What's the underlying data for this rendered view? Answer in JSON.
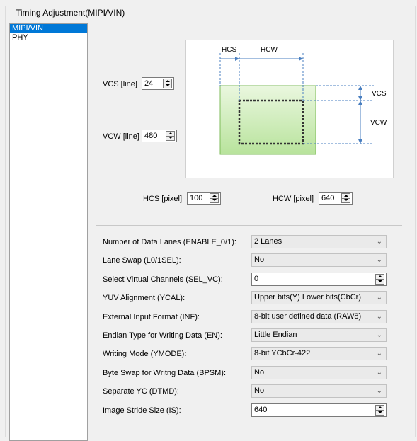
{
  "group": {
    "title": "Timing Adjustment(MIPI/VIN)"
  },
  "nav": {
    "items": [
      "MIPI/VIN",
      "PHY"
    ],
    "selected": "MIPI/VIN"
  },
  "vcs": {
    "label": "VCS [line]",
    "value": "24"
  },
  "vcw": {
    "label": "VCW [line]",
    "value": "480"
  },
  "hcs": {
    "label": "HCS [pixel]",
    "value": "100"
  },
  "hcw": {
    "label": "HCW [pixel]",
    "value": "640"
  },
  "diagram": {
    "hcs_label": "HCS",
    "hcw_label": "HCW",
    "vcs_label": "VCS",
    "vcw_label": "VCW",
    "colors": {
      "fill_top": "#eaf7df",
      "fill_bottom": "#b8e39c",
      "border": "#7dbb58",
      "arrow": "#4a7fc0"
    }
  },
  "settings": [
    {
      "label": "Number of Data Lanes (ENABLE_0/1):",
      "value": "2 Lanes",
      "control": "combo"
    },
    {
      "label": "Lane Swap (L0/1SEL):",
      "value": "No",
      "control": "combo"
    },
    {
      "label": "Select Virtual Channels (SEL_VC):",
      "value": "0",
      "control": "spin"
    },
    {
      "label": "YUV Alignment (YCAL):",
      "value": "Upper bits(Y) Lower bits(CbCr)",
      "control": "combo"
    },
    {
      "label": "External Input Format (INF):",
      "value": "8-bit user defined data (RAW8)",
      "control": "combo"
    },
    {
      "label": "Endian Type for Writing Data (EN):",
      "value": "Little Endian",
      "control": "combo"
    },
    {
      "label": "Writing Mode (YMODE):",
      "value": "8-bit YCbCr-422",
      "control": "combo"
    },
    {
      "label": "Byte Swap for Writng Data (BPSM):",
      "value": "No",
      "control": "combo"
    },
    {
      "label": "Separate YC (DTMD):",
      "value": "No",
      "control": "combo"
    },
    {
      "label": "Image Stride Size (IS):",
      "value": "640",
      "control": "spin"
    }
  ],
  "icons": {
    "dropdown": "chevron-down-icon",
    "spin": "spin-arrows-icon"
  }
}
